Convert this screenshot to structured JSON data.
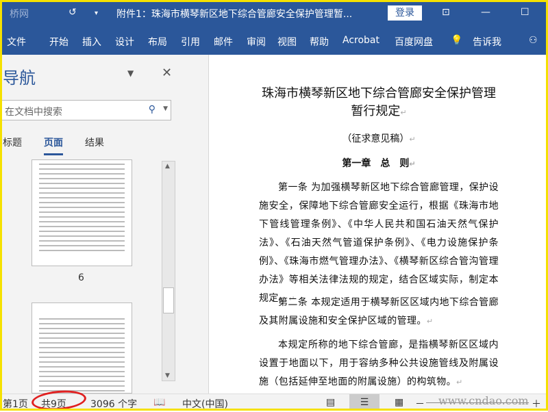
{
  "titlebar": {
    "logo": "桥网",
    "title": "附件1：珠海市横琴新区地下综合管廊安全保护管理暂...",
    "login": "登录"
  },
  "ribbon": {
    "tabs": [
      "文件",
      "开始",
      "插入",
      "设计",
      "布局",
      "引用",
      "邮件",
      "审阅",
      "视图",
      "帮助",
      "Acrobat",
      "百度网盘"
    ],
    "tell_me": "告诉我"
  },
  "nav": {
    "title": "导航",
    "search_placeholder": "在文档中搜索",
    "tabs": [
      "标题",
      "页面",
      "结果"
    ],
    "active_tab": "页面",
    "page_label": "6"
  },
  "doc": {
    "title": "珠海市横琴新区地下综合管廊安全保护管理暂行规定",
    "subtitle": "（征求意见稿）",
    "chapter": "第一章　总　则",
    "paragraphs": [
      "第一条 为加强横琴新区地下综合管廊管理，保护设施安全，保障地下综合管廊安全运行，根据《珠海市地下管线管理条例》、《中华人民共和国石油天然气保护法》、《石油天然气管道保护条例》、《电力设施保护条例》、《珠海市燃气管理办法》、《横琴新区综合管沟管理办法》等相关法律法规的规定，结合区域实际，制定本规定。",
      "第二条 本规定适用于横琴新区区域内地下综合管廊及其附属设施和安全保护区域的管理。",
      "本规定所称的地下综合管廊，是指横琴新区区域内设置于地面以下，用于容纳多种公共设施管线及附属设施（包括延伸至地面的附属设施）的构筑物。"
    ]
  },
  "status": {
    "page": "第1页",
    "total": "共9页",
    "words": "3096 个字",
    "lang": "中文(中国)",
    "watermark": "www.cndao.com"
  },
  "colors": {
    "brand": "#2b579a",
    "highlight": "#e02020"
  }
}
